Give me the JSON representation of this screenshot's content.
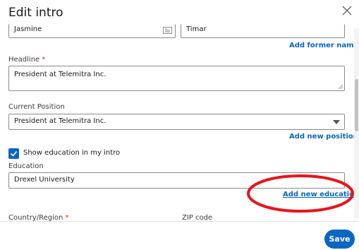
{
  "header": {
    "title": "Edit intro",
    "close_icon": "close-icon"
  },
  "name_section": {
    "first_name": "Jasmine",
    "last_name": "Timar",
    "first_name_icon": "card-icon"
  },
  "add_former_name": "Add former name",
  "headline": {
    "label": "Headline",
    "required_mark": "*",
    "value": "President at Telemitra Inc."
  },
  "current_position": {
    "label": "Current Position",
    "selected": "President at Telemitra Inc.",
    "add_link": "Add new position"
  },
  "show_education": {
    "checked": true,
    "label": "Show education in my intro"
  },
  "education": {
    "label": "Education",
    "selected": "Drexel University",
    "add_link": "Add new education"
  },
  "country": {
    "label": "Country/Region",
    "required_mark": "*"
  },
  "zip": {
    "label": "ZIP code"
  },
  "footer": {
    "save_label": "Save"
  },
  "annotation": {
    "shape": "ellipse",
    "color": "#e8141c"
  },
  "colors": {
    "link": "#0a66c2",
    "required": "#b24020",
    "save_bg": "#0a66c2"
  }
}
